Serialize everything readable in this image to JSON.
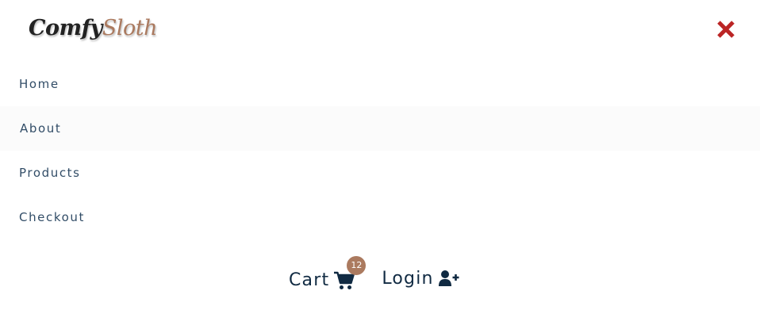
{
  "header": {
    "logo_part1": "Comfy",
    "logo_part2": "Sloth",
    "close_icon": "close-icon",
    "close_color": "#bb2525"
  },
  "nav": {
    "items": [
      {
        "label": "Home"
      },
      {
        "label": "About"
      },
      {
        "label": "Products"
      },
      {
        "label": "Checkout"
      }
    ]
  },
  "actions": {
    "cart_label": "Cart",
    "cart_icon": "shopping-cart-icon",
    "cart_count": "12",
    "login_label": "Login",
    "login_icon": "user-plus-icon"
  },
  "colors": {
    "primary_dark": "#102a42",
    "accent_brown": "#ab7a5f",
    "nav_text": "#324d67"
  }
}
